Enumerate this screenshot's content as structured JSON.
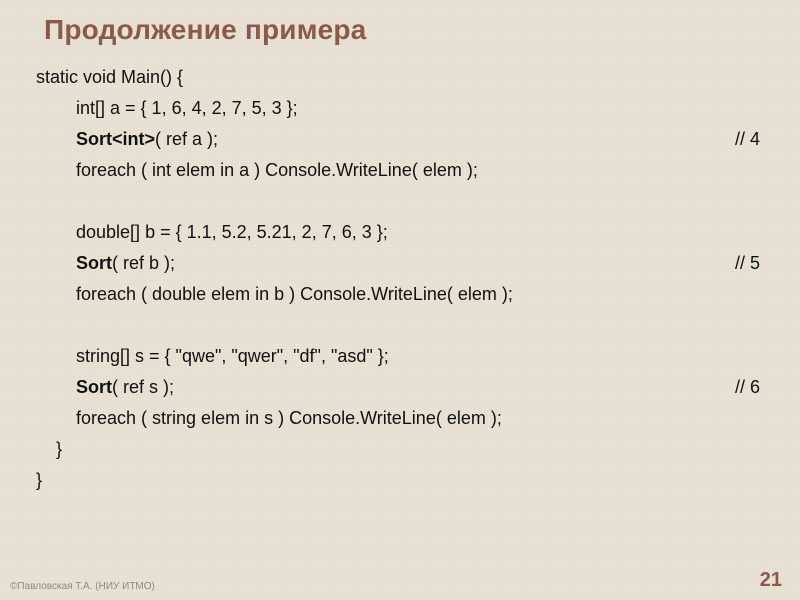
{
  "title": "Продолжение примера",
  "code": {
    "l0": "static void Main() {",
    "l1": "        int[] a = { 1, 6, 4, 2, 7, 5, 3 };",
    "l2a": "        ",
    "l2b": "Sort<int>",
    "l2c": "( ref a );",
    "l2d": "// 4",
    "l3": "        foreach ( int elem in a ) Console.WriteLine( elem );",
    "l4": "        double[] b = { 1.1, 5.2, 5.21, 2, 7, 6, 3 };",
    "l5a": "        ",
    "l5b": "Sort",
    "l5c": "( ref b );",
    "l5d": "// 5",
    "l6": "        foreach ( double elem in b ) Console.WriteLine( elem );",
    "l7": "        string[] s = { \"qwe\", \"qwer\", \"df\", \"asd\" };",
    "l8a": "        ",
    "l8b": "Sort",
    "l8c": "( ref s );",
    "l8d": "// 6",
    "l9": "        foreach ( string elem in s ) Console.WriteLine( elem );",
    "l10": "    }",
    "l11": "}"
  },
  "footer": "©Павловская Т.А. (НИУ ИТМО)",
  "page": "21"
}
